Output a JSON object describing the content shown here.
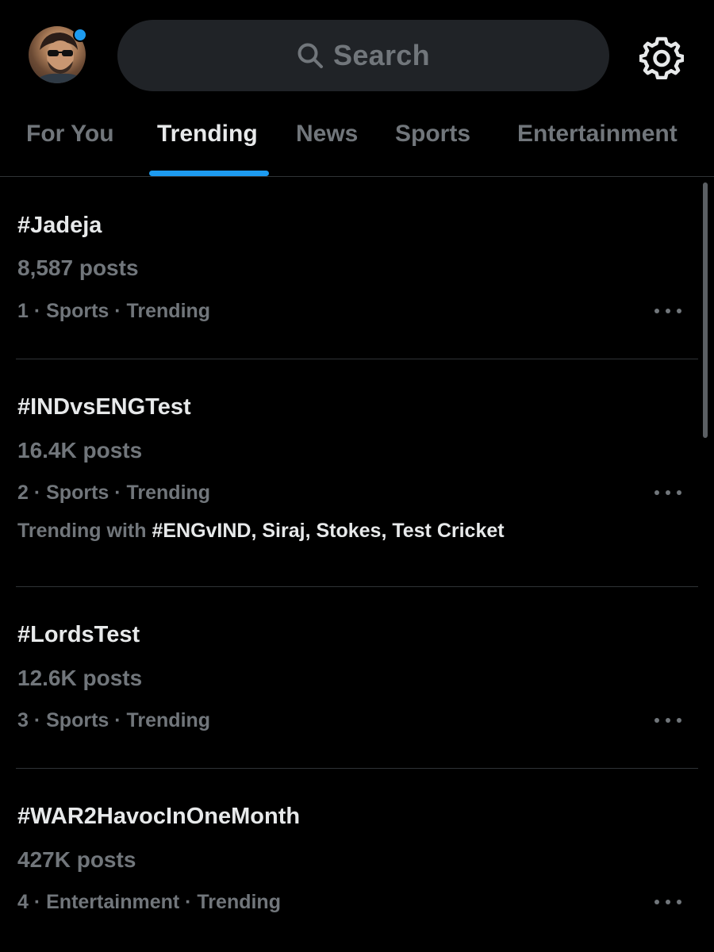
{
  "header": {
    "search_placeholder": "Search",
    "accent_color": "#1d9bf0",
    "icons": {
      "search": "search-icon",
      "settings": "gear-icon",
      "notification_dot": "notification-dot"
    }
  },
  "tabs": [
    {
      "label": "For You",
      "active": false
    },
    {
      "label": "Trending",
      "active": true
    },
    {
      "label": "News",
      "active": false
    },
    {
      "label": "Sports",
      "active": false
    },
    {
      "label": "Entertainment",
      "active": false
    }
  ],
  "trends": [
    {
      "title": "#Jadeja",
      "count": "8,587 posts",
      "meta": "1 · Sports · Trending"
    },
    {
      "title": "#INDvsENGTest",
      "count": "16.4K posts",
      "meta": "2 · Sports · Trending",
      "with_label": "Trending with ",
      "with_terms": "#ENGvIND, Siraj, Stokes, Test Cricket"
    },
    {
      "title": "#LordsTest",
      "count": "12.6K posts",
      "meta": "3 · Sports · Trending"
    },
    {
      "title": "#WAR2HavocInOneMonth",
      "count": "427K posts",
      "meta": "4 · Entertainment · Trending"
    }
  ],
  "colors": {
    "background": "#000000",
    "primary_text": "#e7e9ea",
    "secondary_text": "#71767b",
    "divider": "#2f3336",
    "search_bg": "#202327"
  }
}
